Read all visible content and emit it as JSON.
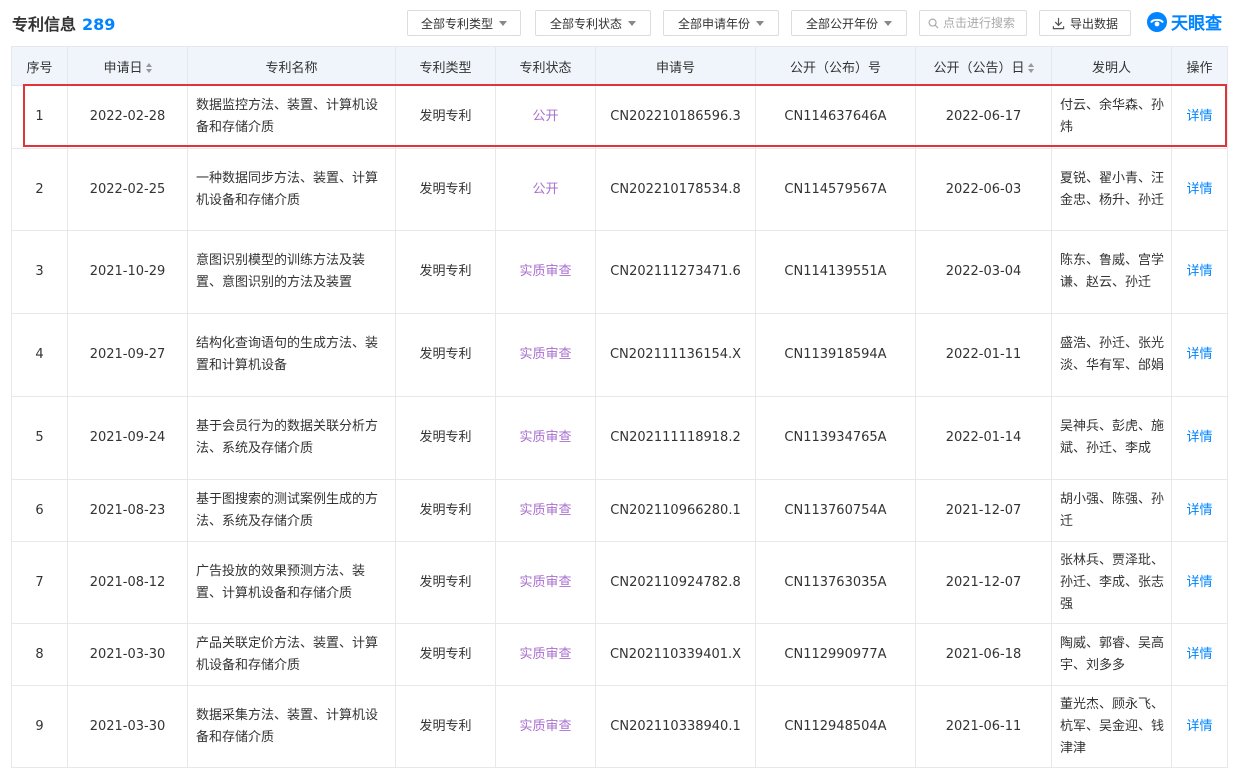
{
  "header": {
    "title": "专利信息",
    "count": "289",
    "filters": [
      "全部专利类型",
      "全部专利状态",
      "全部申请年份",
      "全部公开年份"
    ],
    "search_placeholder": "点击进行搜索",
    "export_label": "导出数据",
    "logo_text": "天眼查"
  },
  "table": {
    "columns": [
      "序号",
      "申请日",
      "专利名称",
      "专利类型",
      "专利状态",
      "申请号",
      "公开（公布）号",
      "公开（公告）日",
      "发明人",
      "操作"
    ],
    "rows": [
      {
        "no": "1",
        "date": "2022-02-28",
        "name": "数据监控方法、装置、计算机设备和存储介质",
        "type": "发明专利",
        "status": "公开",
        "app_no": "CN202210186596.3",
        "pub_no": "CN114637646A",
        "pub_date": "2022-06-17",
        "inventors": "付云、余华森、孙炜",
        "action": "详情"
      },
      {
        "no": "2",
        "date": "2022-02-25",
        "name": "一种数据同步方法、装置、计算机设备和存储介质",
        "type": "发明专利",
        "status": "公开",
        "app_no": "CN202210178534.8",
        "pub_no": "CN114579567A",
        "pub_date": "2022-06-03",
        "inventors": "夏锐、翟小青、汪金忠、杨升、孙迁",
        "action": "详情"
      },
      {
        "no": "3",
        "date": "2021-10-29",
        "name": "意图识别模型的训练方法及装置、意图识别的方法及装置",
        "type": "发明专利",
        "status": "实质审查",
        "app_no": "CN202111273471.6",
        "pub_no": "CN114139551A",
        "pub_date": "2022-03-04",
        "inventors": "陈东、鲁威、宫学谦、赵云、孙迁",
        "action": "详情"
      },
      {
        "no": "4",
        "date": "2021-09-27",
        "name": "结构化查询语句的生成方法、装置和计算机设备",
        "type": "发明专利",
        "status": "实质审查",
        "app_no": "CN202111136154.X",
        "pub_no": "CN113918594A",
        "pub_date": "2022-01-11",
        "inventors": "盛浩、孙迁、张光淡、华有军、邰娟",
        "action": "详情"
      },
      {
        "no": "5",
        "date": "2021-09-24",
        "name": "基于会员行为的数据关联分析方法、系统及存储介质",
        "type": "发明专利",
        "status": "实质审查",
        "app_no": "CN202111118918.2",
        "pub_no": "CN113934765A",
        "pub_date": "2022-01-14",
        "inventors": "吴神兵、彭虎、施斌、孙迁、李成",
        "action": "详情"
      },
      {
        "no": "6",
        "date": "2021-08-23",
        "name": "基于图搜索的测试案例生成的方法、系统及存储介质",
        "type": "发明专利",
        "status": "实质审查",
        "app_no": "CN202110966280.1",
        "pub_no": "CN113760754A",
        "pub_date": "2021-12-07",
        "inventors": "胡小强、陈强、孙迁",
        "action": "详情"
      },
      {
        "no": "7",
        "date": "2021-08-12",
        "name": "广告投放的效果预测方法、装置、计算机设备和存储介质",
        "type": "发明专利",
        "status": "实质审查",
        "app_no": "CN202110924782.8",
        "pub_no": "CN113763035A",
        "pub_date": "2021-12-07",
        "inventors": "张林兵、贾泽玭、孙迁、李成、张志强",
        "action": "详情"
      },
      {
        "no": "8",
        "date": "2021-03-30",
        "name": "产品关联定价方法、装置、计算机设备和存储介质",
        "type": "发明专利",
        "status": "实质审查",
        "app_no": "CN202110339401.X",
        "pub_no": "CN112990977A",
        "pub_date": "2021-06-18",
        "inventors": "陶威、郭睿、吴高宇、刘多多",
        "action": "详情"
      },
      {
        "no": "9",
        "date": "2021-03-30",
        "name": "数据采集方法、装置、计算机设备和存储介质",
        "type": "发明专利",
        "status": "实质审查",
        "app_no": "CN202110338940.1",
        "pub_no": "CN112948504A",
        "pub_date": "2021-06-11",
        "inventors": "董光杰、顾永飞、杭军、吴金迎、钱津津",
        "action": "详情"
      }
    ]
  },
  "colors": {
    "accent": "#0084ff",
    "status": "#a86fcf",
    "highlight": "#e0343a",
    "header_bg": "#f0f5fb"
  }
}
